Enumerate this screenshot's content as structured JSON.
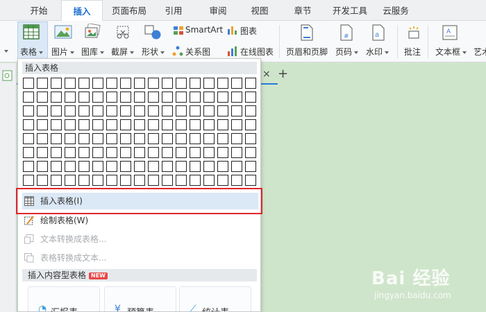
{
  "menu_tabs": [
    {
      "label": "开始",
      "active": false
    },
    {
      "label": "插入",
      "active": true
    },
    {
      "label": "页面布局",
      "active": false
    },
    {
      "label": "引用",
      "active": false
    },
    {
      "label": "审阅",
      "active": false
    },
    {
      "label": "视图",
      "active": false
    },
    {
      "label": "章节",
      "active": false
    },
    {
      "label": "开发工具",
      "active": false
    },
    {
      "label": "云服务",
      "active": false
    }
  ],
  "ribbon": {
    "table": "表格",
    "picture": "图片",
    "gallery": "图库",
    "screenshot": "截屏",
    "shapes": "形状",
    "smartart": "SmartArt",
    "relation": "关系图",
    "chart": "图表",
    "online_chart": "在线图表",
    "header_footer": "页眉和页脚",
    "page_number": "页码",
    "watermark": "水印",
    "comment": "批注",
    "textbox": "文本框",
    "art_text": "艺术"
  },
  "document": {
    "close_glyph": "×",
    "new_tab_glyph": "+"
  },
  "dropdown": {
    "header": "插入表格",
    "grid_cols": 17,
    "grid_rows": 8,
    "items": [
      {
        "label": "插入表格(I)",
        "state": "selected"
      },
      {
        "label": "绘制表格(W)",
        "state": "normal"
      },
      {
        "label": "文本转换成表格...",
        "state": "disabled"
      },
      {
        "label": "表格转换成文本...",
        "state": "disabled"
      }
    ],
    "section2": "插入内容型表格",
    "section2_badge": "NEW",
    "cards": [
      "汇报表",
      "预算表",
      "统计表"
    ]
  },
  "watermark": {
    "brand": "Bai 经验",
    "url": "jingyan.baidu.com"
  },
  "colors": {
    "accent": "#1e6fcf",
    "highlight_border": "#e0262b",
    "selected_bg": "#dbe8f6",
    "doc_bg": "#cfe5cb"
  }
}
